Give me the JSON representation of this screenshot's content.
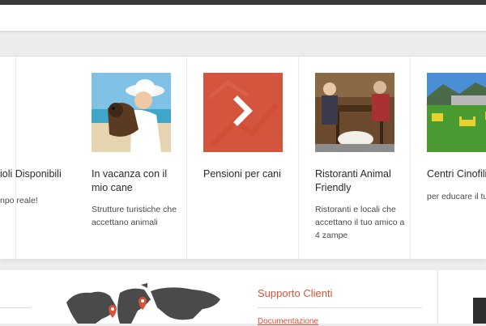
{
  "cards": [
    {
      "title": "ioli Disponibili",
      "desc": "npo reale!"
    },
    {
      "title": "In vacanza con il mio cane",
      "desc": "Strutture turistiche che accettano animali"
    },
    {
      "title": "Pensioni per cani",
      "desc": ""
    },
    {
      "title": "Ristoranti Animal Friendly",
      "desc": "Ristoranti e locali che accettano il tuo amico a 4 zampe"
    },
    {
      "title": "Centri Cinofili",
      "desc": "per educare il tuo"
    }
  ],
  "footer": {
    "support_title": "Supporto Clienti",
    "doc_link": "Documentazione"
  },
  "colors": {
    "accent": "#d9523a"
  }
}
